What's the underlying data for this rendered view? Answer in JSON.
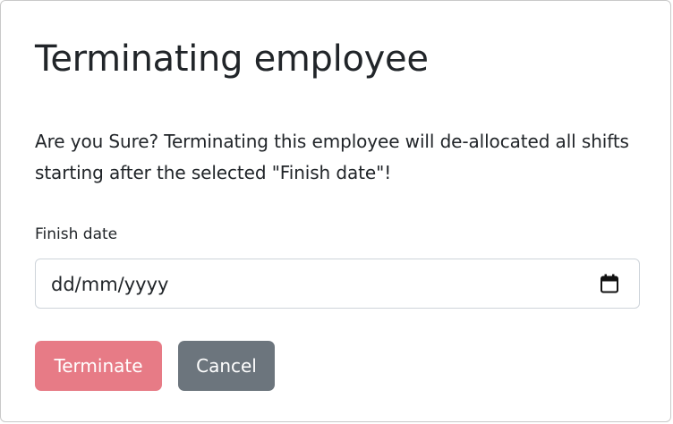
{
  "dialog": {
    "title": "Terminating employee",
    "message": "Are you Sure? Terminating this employee will de-allocated all shifts starting after the selected \"Finish date\"!",
    "finish_date": {
      "label": "Finish date",
      "placeholder": "dd/mm/yyyy",
      "value": "",
      "icon": "calendar-icon"
    },
    "buttons": {
      "terminate_label": "Terminate",
      "cancel_label": "Cancel"
    }
  },
  "colors": {
    "terminate_button": "#e77b86",
    "cancel_button": "#6c757d",
    "text": "#212529",
    "input_border": "#ced4da"
  }
}
